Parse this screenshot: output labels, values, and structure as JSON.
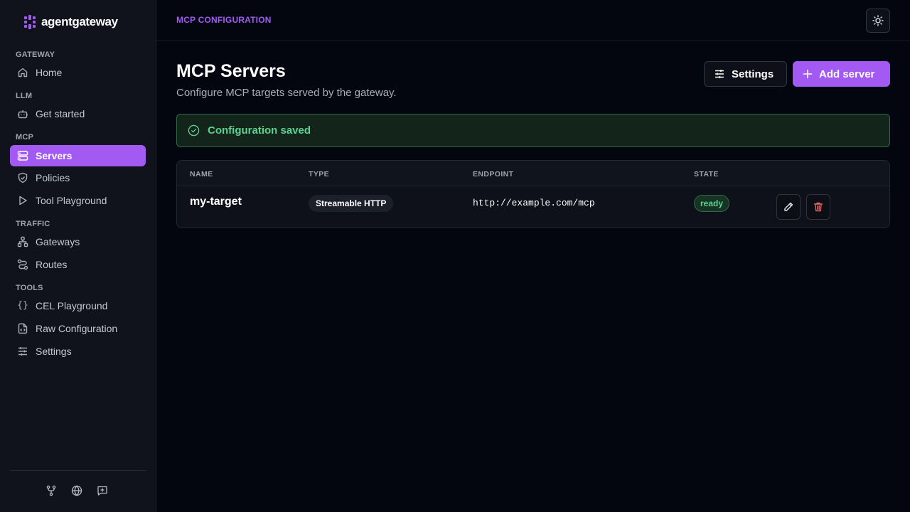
{
  "brand": {
    "name": "agentgateway",
    "accent": "#a25af3"
  },
  "sidebar": {
    "groups": [
      {
        "label": "GATEWAY",
        "items": [
          {
            "label": "Home",
            "icon": "home-icon"
          }
        ]
      },
      {
        "label": "LLM",
        "items": [
          {
            "label": "Get started",
            "icon": "bot-icon"
          }
        ]
      },
      {
        "label": "MCP",
        "items": [
          {
            "label": "Servers",
            "icon": "server-icon",
            "active": true
          },
          {
            "label": "Policies",
            "icon": "shield-icon"
          },
          {
            "label": "Tool Playground",
            "icon": "play-icon"
          }
        ]
      },
      {
        "label": "TRAFFIC",
        "items": [
          {
            "label": "Gateways",
            "icon": "network-icon"
          },
          {
            "label": "Routes",
            "icon": "route-icon"
          }
        ]
      },
      {
        "label": "TOOLS",
        "items": [
          {
            "label": "CEL Playground",
            "icon": "braces-icon"
          },
          {
            "label": "Raw Configuration",
            "icon": "file-code-icon"
          },
          {
            "label": "Settings",
            "icon": "sliders-icon"
          }
        ]
      }
    ],
    "footer_icons": [
      "git-fork-icon",
      "globe-icon",
      "message-plus-icon"
    ]
  },
  "topbar": {
    "breadcrumb": "MCP CONFIGURATION",
    "theme_icon": "sun-icon"
  },
  "page": {
    "title": "MCP Servers",
    "subtitle": "Configure MCP targets served by the gateway.",
    "settings_button": "Settings",
    "add_button": "Add server"
  },
  "alert": {
    "text": "Configuration saved",
    "color": "#5fd190"
  },
  "table": {
    "headers": [
      "NAME",
      "TYPE",
      "ENDPOINT",
      "STATE"
    ],
    "rows": [
      {
        "name": "my-target",
        "type": "Streamable HTTP",
        "endpoint": "http://example.com/mcp",
        "state": "ready"
      }
    ]
  }
}
